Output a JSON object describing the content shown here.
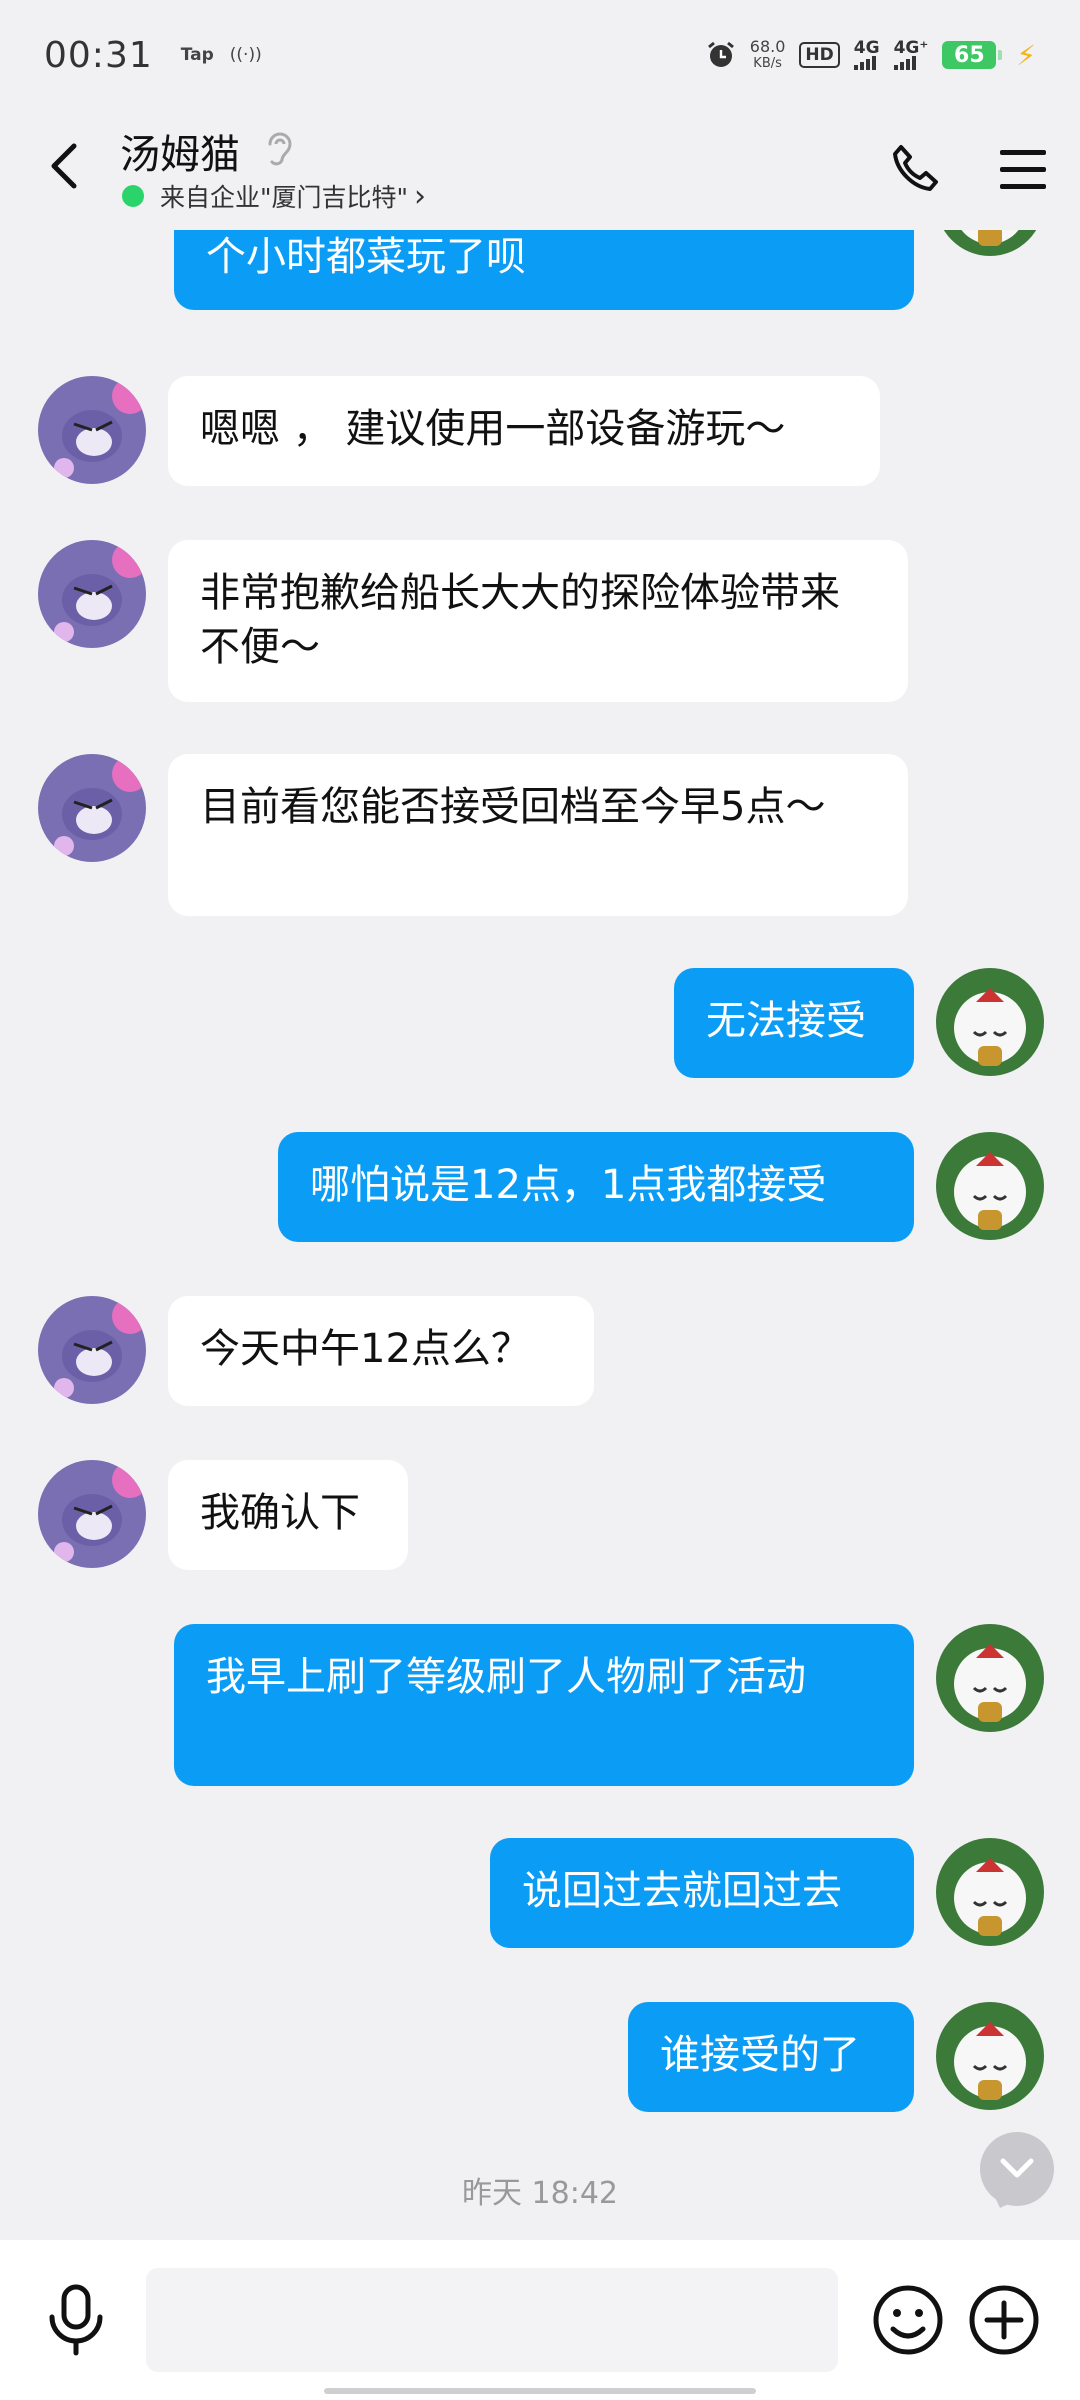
{
  "status_bar": {
    "time": "00:31",
    "tap_label": "Tap",
    "speed_value": "68.0",
    "speed_unit": "KB/s",
    "hd_label": "HD",
    "net1": "4G",
    "net2": "4G⁺",
    "battery": "65"
  },
  "header": {
    "contact_name": "汤姆猫",
    "company": "来自企业\"厦门吉比特\"",
    "company_chevron": "›"
  },
  "messages": [
    {
      "side": "me",
      "text": "个小时都菜玩了呗"
    },
    {
      "side": "them",
      "text": "嗯嗯 ， 建议使用一部设备游玩～"
    },
    {
      "side": "them",
      "text": "非常抱歉给船长大大的探险体验带来不便～"
    },
    {
      "side": "them",
      "text": "目前看您能否接受回档至今早5点～"
    },
    {
      "side": "me",
      "text": "无法接受"
    },
    {
      "side": "me",
      "text": "哪怕说是12点，1点我都接受"
    },
    {
      "side": "them",
      "text": "今天中午12点么？"
    },
    {
      "side": "them",
      "text": "我确认下"
    },
    {
      "side": "me",
      "text": "我早上刷了等级刷了人物刷了活动"
    },
    {
      "side": "me",
      "text": "说回过去就回过去"
    },
    {
      "side": "me",
      "text": "谁接受的了"
    }
  ],
  "timestamp": "昨天 18:42",
  "input": {
    "value": "",
    "placeholder": ""
  },
  "colors": {
    "my_bubble": "#0b9cf5",
    "their_bubble": "#ffffff",
    "background": "#f1f1f3"
  }
}
